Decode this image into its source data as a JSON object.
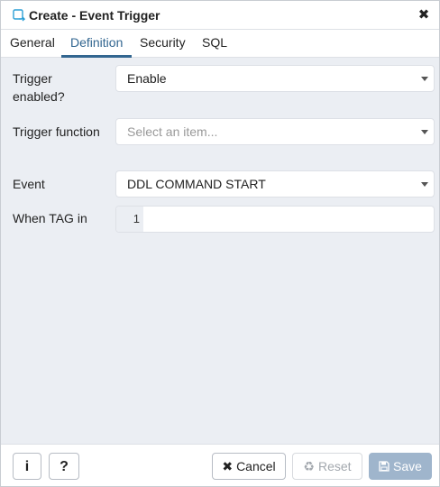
{
  "dialog": {
    "title": "Create - Event Trigger",
    "close_glyph": "✖"
  },
  "tabs": [
    {
      "label": "General",
      "active": false
    },
    {
      "label": "Definition",
      "active": true
    },
    {
      "label": "Security",
      "active": false
    },
    {
      "label": "SQL",
      "active": false
    }
  ],
  "form": {
    "trigger_enabled": {
      "label": "Trigger enabled?",
      "value": "Enable"
    },
    "trigger_function": {
      "label": "Trigger function",
      "placeholder": "Select an item..."
    },
    "event": {
      "label": "Event",
      "value": "DDL COMMAND START"
    },
    "when_tag": {
      "label": "When TAG in",
      "line_number": "1",
      "value": ""
    }
  },
  "footer": {
    "info_glyph": "i",
    "help_glyph": "?",
    "cancel_icon": "✖",
    "cancel_label": "Cancel",
    "reset_icon": "♻",
    "reset_label": "Reset",
    "save_icon": "💾",
    "save_label": "Save"
  },
  "colors": {
    "accent": "#326690",
    "panel_bg": "#ebeef3",
    "save_disabled": "#9fb5cc"
  },
  "icons": {
    "title": "event-trigger-icon",
    "close": "close-icon",
    "caret": "chevron-down-icon",
    "info": "info-icon",
    "help": "help-icon",
    "cancel": "close-icon",
    "reset": "recycle-icon",
    "save": "floppy-disk-icon"
  }
}
